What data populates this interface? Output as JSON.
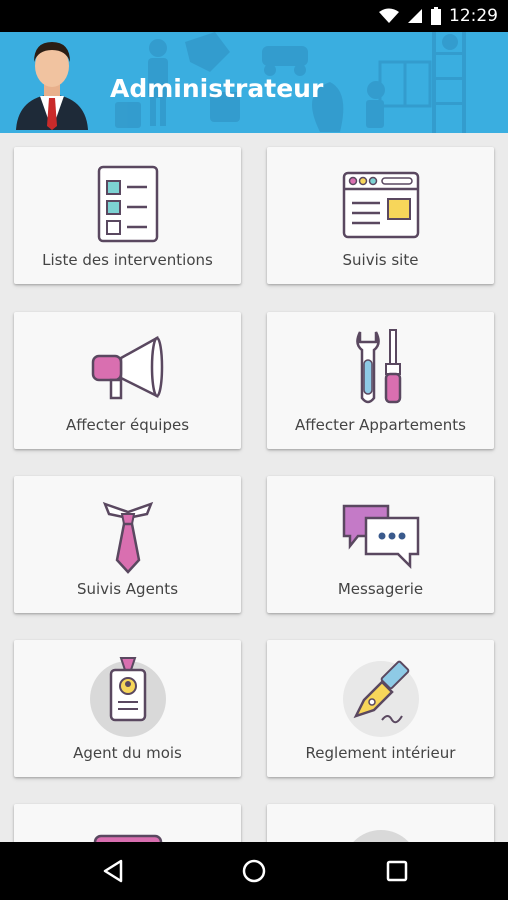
{
  "status_bar": {
    "time": "12:29",
    "icons": [
      "wifi-icon",
      "signal-icon",
      "battery-icon"
    ]
  },
  "header": {
    "title": "Administrateur",
    "background_color": "#3aaee0"
  },
  "menu": {
    "items": [
      {
        "label": "Liste des interventions",
        "icon": "checklist-icon"
      },
      {
        "label": "Suivis site",
        "icon": "browser-window-icon"
      },
      {
        "label": "Affecter équipes",
        "icon": "megaphone-icon"
      },
      {
        "label": "Affecter Appartements",
        "icon": "tools-icon"
      },
      {
        "label": "Suivis Agents",
        "icon": "tie-icon"
      },
      {
        "label": "Messagerie",
        "icon": "chat-bubbles-icon"
      },
      {
        "label": "Agent du mois",
        "icon": "id-badge-icon"
      },
      {
        "label": "Reglement intérieur",
        "icon": "fountain-pen-icon"
      }
    ]
  },
  "nav_bar": {
    "icons": [
      "back-icon",
      "home-icon",
      "recents-icon"
    ]
  },
  "colors": {
    "accent_pink": "#d96fb0",
    "accent_teal": "#7dd3d3",
    "accent_yellow": "#f7d65a",
    "accent_blue": "#8ecae6",
    "outline": "#5a4860"
  }
}
